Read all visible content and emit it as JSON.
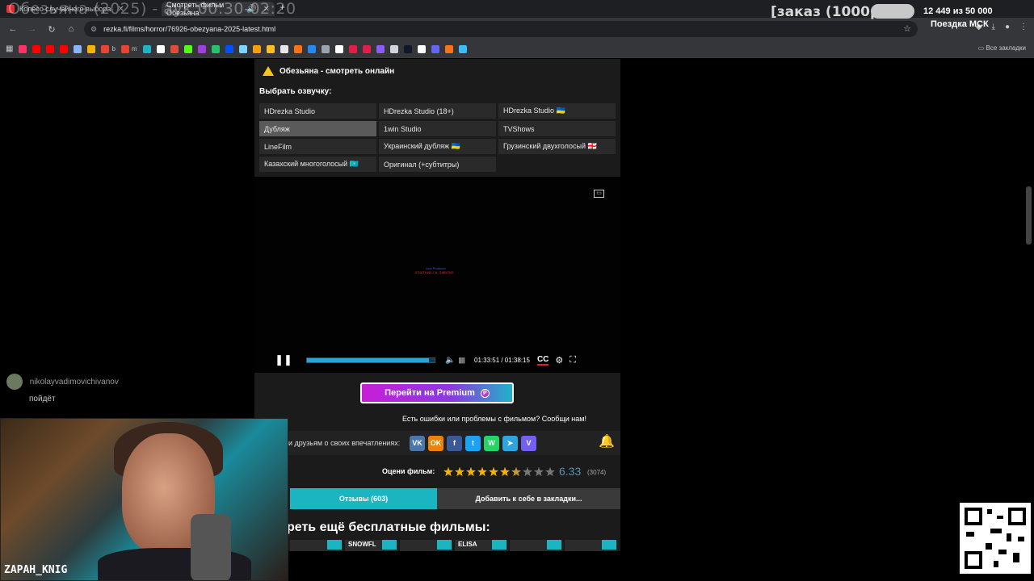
{
  "tabs": [
    {
      "label": "Колесо случайного выбора",
      "active": false
    },
    {
      "label": "Смотреть фильм Обезьяна",
      "active": true
    }
  ],
  "overlay": {
    "title": "Обезьяна (2025) - аук 00:30-02:20",
    "zakaz": "[заказ (1000р]",
    "counter": "12 449  из 50 000",
    "poezdka": "Поездка МСК"
  },
  "address": {
    "url": "rezka.fi/films/horror/76926-obezyana-2025-latest.html"
  },
  "bookmarks": {
    "items": [
      {
        "icon": "lamoda-icon",
        "label": "",
        "color": "#ff3366"
      },
      {
        "icon": "youtube-icon",
        "label": "",
        "color": "#ff0000"
      },
      {
        "icon": "youtube-icon",
        "label": "",
        "color": "#ff0000"
      },
      {
        "icon": "youtube-icon",
        "label": "",
        "color": "#ff0000"
      },
      {
        "icon": "gear-icon",
        "label": "",
        "color": "#8ab4f8"
      },
      {
        "icon": "mail-icon",
        "label": "",
        "color": "#f4b400"
      },
      {
        "icon": "gmail-icon",
        "label": "b",
        "color": "#ea4335"
      },
      {
        "icon": "gmail-icon",
        "label": "m",
        "color": "#ea4335"
      },
      {
        "icon": "edge-icon",
        "label": "",
        "color": "#1db5c4"
      },
      {
        "icon": "plus-icon",
        "label": "",
        "color": "#ffffff"
      },
      {
        "icon": "heart-icon",
        "label": "",
        "color": "#e04b3a"
      },
      {
        "icon": "kick-icon",
        "label": "",
        "color": "#53fc18"
      },
      {
        "icon": "wb-icon",
        "label": "",
        "color": "#a13ee0"
      },
      {
        "icon": "map-icon",
        "label": "",
        "color": "#27c36a"
      },
      {
        "icon": "ozon-icon",
        "label": "",
        "color": "#0050ff"
      },
      {
        "icon": "atom-icon",
        "label": "",
        "color": "#7dd3fc"
      },
      {
        "icon": "star-icon",
        "label": "",
        "color": "#f59e0b"
      },
      {
        "icon": "alert-icon",
        "label": "",
        "color": "#fbbf24"
      },
      {
        "icon": "circle-icon",
        "label": "",
        "color": "#e5e7eb"
      },
      {
        "icon": "game-icon",
        "label": "",
        "color": "#f97316"
      },
      {
        "icon": "vk-icon",
        "label": "",
        "color": "#2787f5"
      },
      {
        "icon": "tag-icon",
        "label": "",
        "color": "#9ca3af"
      },
      {
        "icon": "k-icon",
        "label": "",
        "color": "#ffffff"
      },
      {
        "icon": "s-icon",
        "label": "",
        "color": "#e11d48"
      },
      {
        "icon": "a-icon",
        "label": "",
        "color": "#e11d48"
      },
      {
        "icon": "cloud-icon",
        "label": "",
        "color": "#8b5cf6"
      },
      {
        "icon": "globe-icon",
        "label": "",
        "color": "#d1d5db"
      },
      {
        "icon": "video-icon",
        "label": "",
        "color": "#111827"
      },
      {
        "icon": "p-icon",
        "label": "",
        "color": "#ffffff"
      },
      {
        "icon": "moon-icon",
        "label": "",
        "color": "#6366f1"
      },
      {
        "icon": "tile-icon",
        "label": "",
        "color": "#f97316"
      },
      {
        "icon": "link-icon",
        "label": "",
        "color": "#38bdf8"
      }
    ],
    "all_label": "Все закладки"
  },
  "player": {
    "warning_title": "Обезьяна - смотреть онлайн",
    "choose_label": "Выбрать озвучку:",
    "dubs": [
      {
        "label": "HDrezka Studio",
        "selected": false
      },
      {
        "label": "HDrezka Studio (18+)",
        "selected": false
      },
      {
        "label": "HDrezka Studio 🇺🇦",
        "selected": false
      },
      {
        "label": "Дубляж",
        "selected": true
      },
      {
        "label": "1win Studio",
        "selected": false
      },
      {
        "label": "TVShows",
        "selected": false
      },
      {
        "label": "LineFilm",
        "selected": false
      },
      {
        "label": "Украинский дубляж 🇺🇦",
        "selected": false
      },
      {
        "label": "Грузинский двухголосый 🇬🇪",
        "selected": false
      },
      {
        "label": "Казахский многоголосый 🇰🇿",
        "selected": false
      },
      {
        "label": "Оригинал (+субтитры)",
        "selected": false
      }
    ],
    "credit_line1": "Line Producer",
    "credit_line2": "JONATHAN J.B. GIBBONS",
    "time": "01:33:51 / 01:38:15",
    "progress_percent": 95.5,
    "cc_label": "CC",
    "premium_label": "Перейти на Premium",
    "report_label": "Есть ошибки или проблемы с фильмом? Сообщи нам!",
    "share_label": "и друзьям о своих впечатлениях:",
    "rate_label": "Оцени фильм:",
    "rating": "6.33",
    "votes": "(3074)",
    "rating_stars": 6.33,
    "reviews_label": "Отзывы (603)",
    "bookmarks_label": "Добавить к себе в закладки...",
    "more_label": "реть ещё бесплатные фильмы:",
    "thumbs": [
      {
        "label": ""
      },
      {
        "label": "SNOWFL"
      },
      {
        "label": ""
      },
      {
        "label": "ELISA"
      },
      {
        "label": ""
      },
      {
        "label": ""
      }
    ]
  },
  "social": [
    {
      "name": "vk",
      "label": "VK",
      "color": "#4a76a8"
    },
    {
      "name": "ok",
      "label": "OK",
      "color": "#ee8208"
    },
    {
      "name": "facebook",
      "label": "f",
      "color": "#3b5998"
    },
    {
      "name": "twitter",
      "label": "t",
      "color": "#1da1f2"
    },
    {
      "name": "whatsapp",
      "label": "W",
      "color": "#25d366"
    },
    {
      "name": "telegram",
      "label": "➤",
      "color": "#2ca5e0"
    },
    {
      "name": "viber",
      "label": "V",
      "color": "#7360f2"
    }
  ],
  "chat": {
    "user": "nikolayvadimovichivanov",
    "message": "пойдёт"
  },
  "webcam": {
    "name": "ZAPAH_KNIG"
  }
}
